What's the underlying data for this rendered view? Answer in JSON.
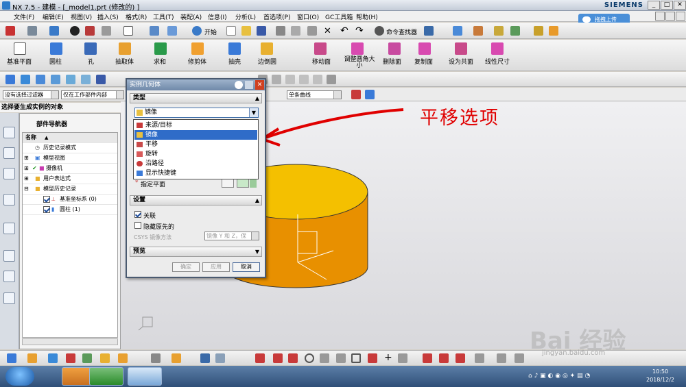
{
  "window": {
    "title": "NX 7.5 - 建模 - [_model1.prt  (修改的) ]",
    "brand": "SIEMENS",
    "min": "_",
    "max": "□",
    "close": "✕"
  },
  "menubar": [
    {
      "label": "文件(F)"
    },
    {
      "label": "编辑(E)"
    },
    {
      "label": "视图(V)"
    },
    {
      "label": "插入(S)"
    },
    {
      "label": "格式(R)"
    },
    {
      "label": "工具(T)"
    },
    {
      "label": "装配(A)"
    },
    {
      "label": "信息(I)"
    },
    {
      "label": "分析(L)"
    },
    {
      "label": "首选项(P)"
    },
    {
      "label": "窗口(O)"
    },
    {
      "label": "GC工具箱"
    },
    {
      "label": "帮助(H)"
    }
  ],
  "cloud_button": "拖拽上传",
  "toolbar1": {
    "start_label": "开始",
    "cmd_finder": "命令查找器"
  },
  "feature_toolbar": [
    {
      "label": "基准平面"
    },
    {
      "label": "圆柱"
    },
    {
      "label": "孔"
    },
    {
      "label": "抽取体"
    },
    {
      "label": "求和"
    },
    {
      "label": "修剪体"
    },
    {
      "label": "抽壳"
    },
    {
      "label": "边倒圆"
    },
    {
      "label": "移动面"
    },
    {
      "label": "调整圆角大小"
    },
    {
      "label": "删除面"
    },
    {
      "label": "复制面"
    },
    {
      "label": "设为共面"
    },
    {
      "label": "线性尺寸"
    }
  ],
  "filters": {
    "selection_filter": "没有选择过滤器",
    "scope": "仅在工作部件内部",
    "curve_rule": "单条曲线"
  },
  "prompt": "选择要生成实例的对象",
  "navigator": {
    "title": "部件导航器",
    "col_name": "名称",
    "rows": [
      "历史记录模式",
      "模型视图",
      "摄像机",
      "用户表达式",
      "模型历史记录",
      "基准坐标系 (0)",
      "圆柱 (1)"
    ]
  },
  "dialog": {
    "title": "实例几何体",
    "type_section": "类型",
    "type_value": "镜像",
    "options": [
      "来源/目标",
      "镜像",
      "平移",
      "旋转",
      "沿路径",
      "显示快捷键"
    ],
    "plane_label": "指定平面",
    "settings_section": "设置",
    "associative": "关联",
    "hide_original": "隐藏原先的",
    "csys_label": "CSYS 镜像方法",
    "csys_value": "镜像 Y 和 Z，保",
    "preview_section": "预览",
    "ok": "确定",
    "apply": "应用",
    "cancel": "取消"
  },
  "annotation": "平移选项",
  "taskbar": {
    "time": "10:50",
    "date": "2018/12/2"
  },
  "watermark": {
    "logo": "Bai 经验",
    "url": "jingyan.baidu.com"
  },
  "colors": {
    "cylinder_top": "#F4C000",
    "cylinder_side": "#E89000",
    "annotation": "#E00000",
    "selection": "#2F6CC8"
  }
}
